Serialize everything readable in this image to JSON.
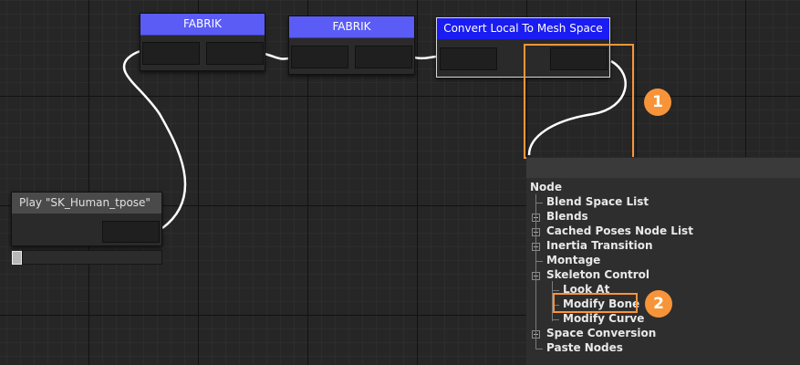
{
  "nodes": {
    "fabrik_1": {
      "title": "FABRIK"
    },
    "fabrik_2": {
      "title": "FABRIK"
    },
    "convert": {
      "title": "Convert Local To Mesh Space"
    },
    "play": {
      "title": "Play \"SK_Human_tpose\""
    }
  },
  "context_menu": {
    "header": "Node",
    "items": [
      {
        "label": "Blend Space List",
        "expandable": false
      },
      {
        "label": "Blends",
        "expandable": true
      },
      {
        "label": "Cached Poses Node List",
        "expandable": true
      },
      {
        "label": "Inertia Transition",
        "expandable": true
      },
      {
        "label": "Montage",
        "expandable": false
      },
      {
        "label": "Skeleton Control",
        "expandable": true,
        "expanded": true,
        "children": [
          {
            "label": "Look At"
          },
          {
            "label": "Modify Bone",
            "highlighted": true
          },
          {
            "label": "Modify Curve"
          }
        ]
      },
      {
        "label": "Space Conversion",
        "expandable": true
      },
      {
        "label": "Paste Nodes",
        "expandable": false
      }
    ]
  },
  "callouts": {
    "one": "1",
    "two": "2"
  },
  "colors": {
    "callout": "#f7943a",
    "fabrik_header": "#5a5cf5",
    "convert_header": "#1a1cf2",
    "wire": "#ffffff"
  }
}
